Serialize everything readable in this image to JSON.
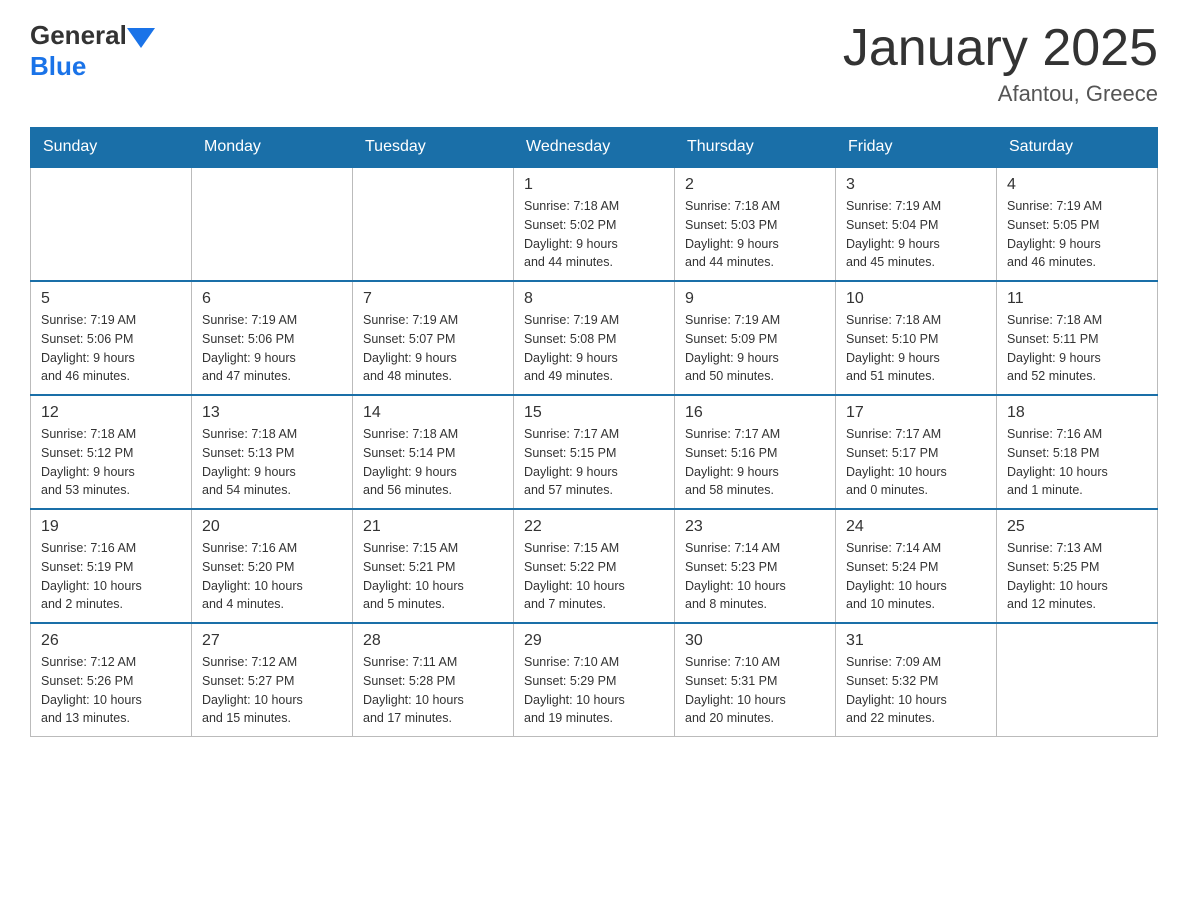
{
  "header": {
    "title": "January 2025",
    "subtitle": "Afantou, Greece",
    "logo_general": "General",
    "logo_blue": "Blue"
  },
  "columns": [
    "Sunday",
    "Monday",
    "Tuesday",
    "Wednesday",
    "Thursday",
    "Friday",
    "Saturday"
  ],
  "weeks": [
    [
      {
        "day": "",
        "info": ""
      },
      {
        "day": "",
        "info": ""
      },
      {
        "day": "",
        "info": ""
      },
      {
        "day": "1",
        "info": "Sunrise: 7:18 AM\nSunset: 5:02 PM\nDaylight: 9 hours\nand 44 minutes."
      },
      {
        "day": "2",
        "info": "Sunrise: 7:18 AM\nSunset: 5:03 PM\nDaylight: 9 hours\nand 44 minutes."
      },
      {
        "day": "3",
        "info": "Sunrise: 7:19 AM\nSunset: 5:04 PM\nDaylight: 9 hours\nand 45 minutes."
      },
      {
        "day": "4",
        "info": "Sunrise: 7:19 AM\nSunset: 5:05 PM\nDaylight: 9 hours\nand 46 minutes."
      }
    ],
    [
      {
        "day": "5",
        "info": "Sunrise: 7:19 AM\nSunset: 5:06 PM\nDaylight: 9 hours\nand 46 minutes."
      },
      {
        "day": "6",
        "info": "Sunrise: 7:19 AM\nSunset: 5:06 PM\nDaylight: 9 hours\nand 47 minutes."
      },
      {
        "day": "7",
        "info": "Sunrise: 7:19 AM\nSunset: 5:07 PM\nDaylight: 9 hours\nand 48 minutes."
      },
      {
        "day": "8",
        "info": "Sunrise: 7:19 AM\nSunset: 5:08 PM\nDaylight: 9 hours\nand 49 minutes."
      },
      {
        "day": "9",
        "info": "Sunrise: 7:19 AM\nSunset: 5:09 PM\nDaylight: 9 hours\nand 50 minutes."
      },
      {
        "day": "10",
        "info": "Sunrise: 7:18 AM\nSunset: 5:10 PM\nDaylight: 9 hours\nand 51 minutes."
      },
      {
        "day": "11",
        "info": "Sunrise: 7:18 AM\nSunset: 5:11 PM\nDaylight: 9 hours\nand 52 minutes."
      }
    ],
    [
      {
        "day": "12",
        "info": "Sunrise: 7:18 AM\nSunset: 5:12 PM\nDaylight: 9 hours\nand 53 minutes."
      },
      {
        "day": "13",
        "info": "Sunrise: 7:18 AM\nSunset: 5:13 PM\nDaylight: 9 hours\nand 54 minutes."
      },
      {
        "day": "14",
        "info": "Sunrise: 7:18 AM\nSunset: 5:14 PM\nDaylight: 9 hours\nand 56 minutes."
      },
      {
        "day": "15",
        "info": "Sunrise: 7:17 AM\nSunset: 5:15 PM\nDaylight: 9 hours\nand 57 minutes."
      },
      {
        "day": "16",
        "info": "Sunrise: 7:17 AM\nSunset: 5:16 PM\nDaylight: 9 hours\nand 58 minutes."
      },
      {
        "day": "17",
        "info": "Sunrise: 7:17 AM\nSunset: 5:17 PM\nDaylight: 10 hours\nand 0 minutes."
      },
      {
        "day": "18",
        "info": "Sunrise: 7:16 AM\nSunset: 5:18 PM\nDaylight: 10 hours\nand 1 minute."
      }
    ],
    [
      {
        "day": "19",
        "info": "Sunrise: 7:16 AM\nSunset: 5:19 PM\nDaylight: 10 hours\nand 2 minutes."
      },
      {
        "day": "20",
        "info": "Sunrise: 7:16 AM\nSunset: 5:20 PM\nDaylight: 10 hours\nand 4 minutes."
      },
      {
        "day": "21",
        "info": "Sunrise: 7:15 AM\nSunset: 5:21 PM\nDaylight: 10 hours\nand 5 minutes."
      },
      {
        "day": "22",
        "info": "Sunrise: 7:15 AM\nSunset: 5:22 PM\nDaylight: 10 hours\nand 7 minutes."
      },
      {
        "day": "23",
        "info": "Sunrise: 7:14 AM\nSunset: 5:23 PM\nDaylight: 10 hours\nand 8 minutes."
      },
      {
        "day": "24",
        "info": "Sunrise: 7:14 AM\nSunset: 5:24 PM\nDaylight: 10 hours\nand 10 minutes."
      },
      {
        "day": "25",
        "info": "Sunrise: 7:13 AM\nSunset: 5:25 PM\nDaylight: 10 hours\nand 12 minutes."
      }
    ],
    [
      {
        "day": "26",
        "info": "Sunrise: 7:12 AM\nSunset: 5:26 PM\nDaylight: 10 hours\nand 13 minutes."
      },
      {
        "day": "27",
        "info": "Sunrise: 7:12 AM\nSunset: 5:27 PM\nDaylight: 10 hours\nand 15 minutes."
      },
      {
        "day": "28",
        "info": "Sunrise: 7:11 AM\nSunset: 5:28 PM\nDaylight: 10 hours\nand 17 minutes."
      },
      {
        "day": "29",
        "info": "Sunrise: 7:10 AM\nSunset: 5:29 PM\nDaylight: 10 hours\nand 19 minutes."
      },
      {
        "day": "30",
        "info": "Sunrise: 7:10 AM\nSunset: 5:31 PM\nDaylight: 10 hours\nand 20 minutes."
      },
      {
        "day": "31",
        "info": "Sunrise: 7:09 AM\nSunset: 5:32 PM\nDaylight: 10 hours\nand 22 minutes."
      },
      {
        "day": "",
        "info": ""
      }
    ]
  ]
}
